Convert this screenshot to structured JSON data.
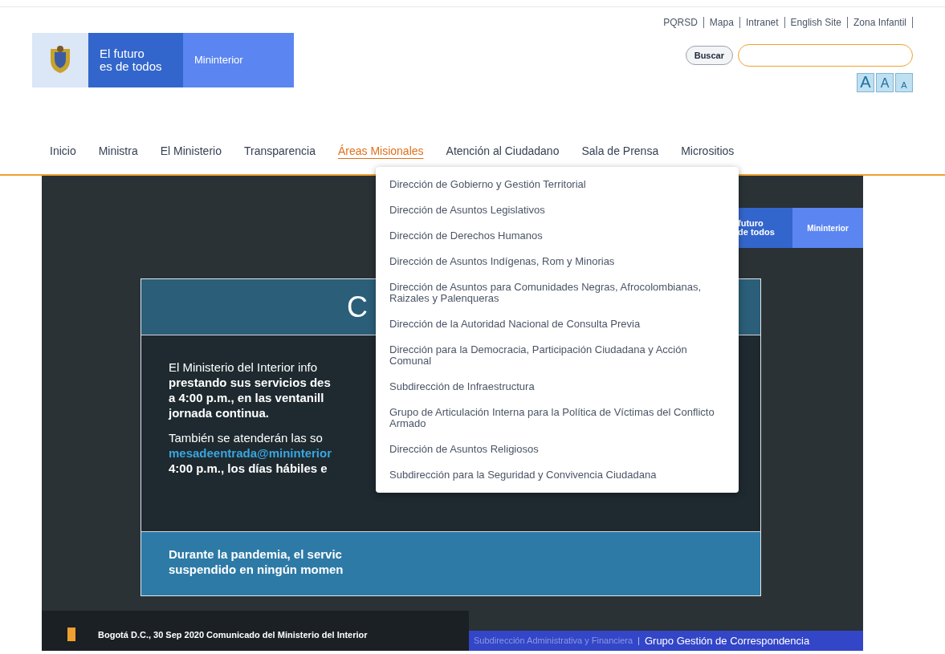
{
  "top_links": [
    "PQRSD",
    "Mapa",
    "Intranet",
    "English Site",
    "Zona Infantil"
  ],
  "logo": {
    "slogan_line_1": "El futuro",
    "slogan_line_2": "es de todos",
    "brand": "Mininterior"
  },
  "search": {
    "button": "Buscar"
  },
  "font_size_buttons": [
    "A",
    "A",
    "A"
  ],
  "nav": [
    {
      "label": "Inicio",
      "selected": false
    },
    {
      "label": "Ministra",
      "selected": false
    },
    {
      "label": "El Ministerio",
      "selected": false
    },
    {
      "label": "Transparencia",
      "selected": false
    },
    {
      "label": "Áreas Misionales",
      "selected": true
    },
    {
      "label": "Atención al Ciudadano",
      "selected": false
    },
    {
      "label": "Sala de Prensa",
      "selected": false
    },
    {
      "label": "Micrositios",
      "selected": false
    }
  ],
  "dropdown": [
    "Dirección de Gobierno y Gestión Territorial",
    "Dirección de Asuntos Legislativos",
    "Dirección de Derechos Humanos",
    "Dirección de Asuntos Indígenas, Rom y Minorias",
    "Dirección de Asuntos para Comunidades Negras, Afrocolombianas, Raizales y Palenqueras",
    "Dirección de la Autoridad Nacional de Consulta Previa",
    "Dirección para la Democracia, Participación Ciudadana y Acción Comunal",
    "Subdirección de Infraestructura",
    "Grupo de Articulación Interna para la Política de Víctimas del Conflicto Armado",
    "Dirección de Asuntos Religiosos",
    "Subdirección para la Seguridad y Convivencia Ciudadana"
  ],
  "banner": {
    "logo_slogan_line_1": "futuro",
    "logo_slogan_line_2": "de todos",
    "logo_brand": "Mininterior",
    "title": "C",
    "paragraph_1": [
      "El Ministerio del Interior info",
      "**prestando sus servicios des**",
      "**a 4:00 p.m., en las ventanill**",
      "**jornada continua.**"
    ],
    "paragraph_2": [
      "También se atenderán las so",
      "mesadeentrada@mininterior",
      "**4:00 p.m., los días hábiles e**"
    ],
    "footer_lines": [
      "Durante la pandemia, el servic",
      "suspendido en ningún momen"
    ]
  },
  "ticker": {
    "text": "Bogotá D.C., 30 Sep 2020 Comunicado del Ministerio del Interior",
    "faded": "Subdirección Administrativa y Financiera",
    "separator": "|",
    "trail": "Grupo Gestión de Correspondencia"
  }
}
